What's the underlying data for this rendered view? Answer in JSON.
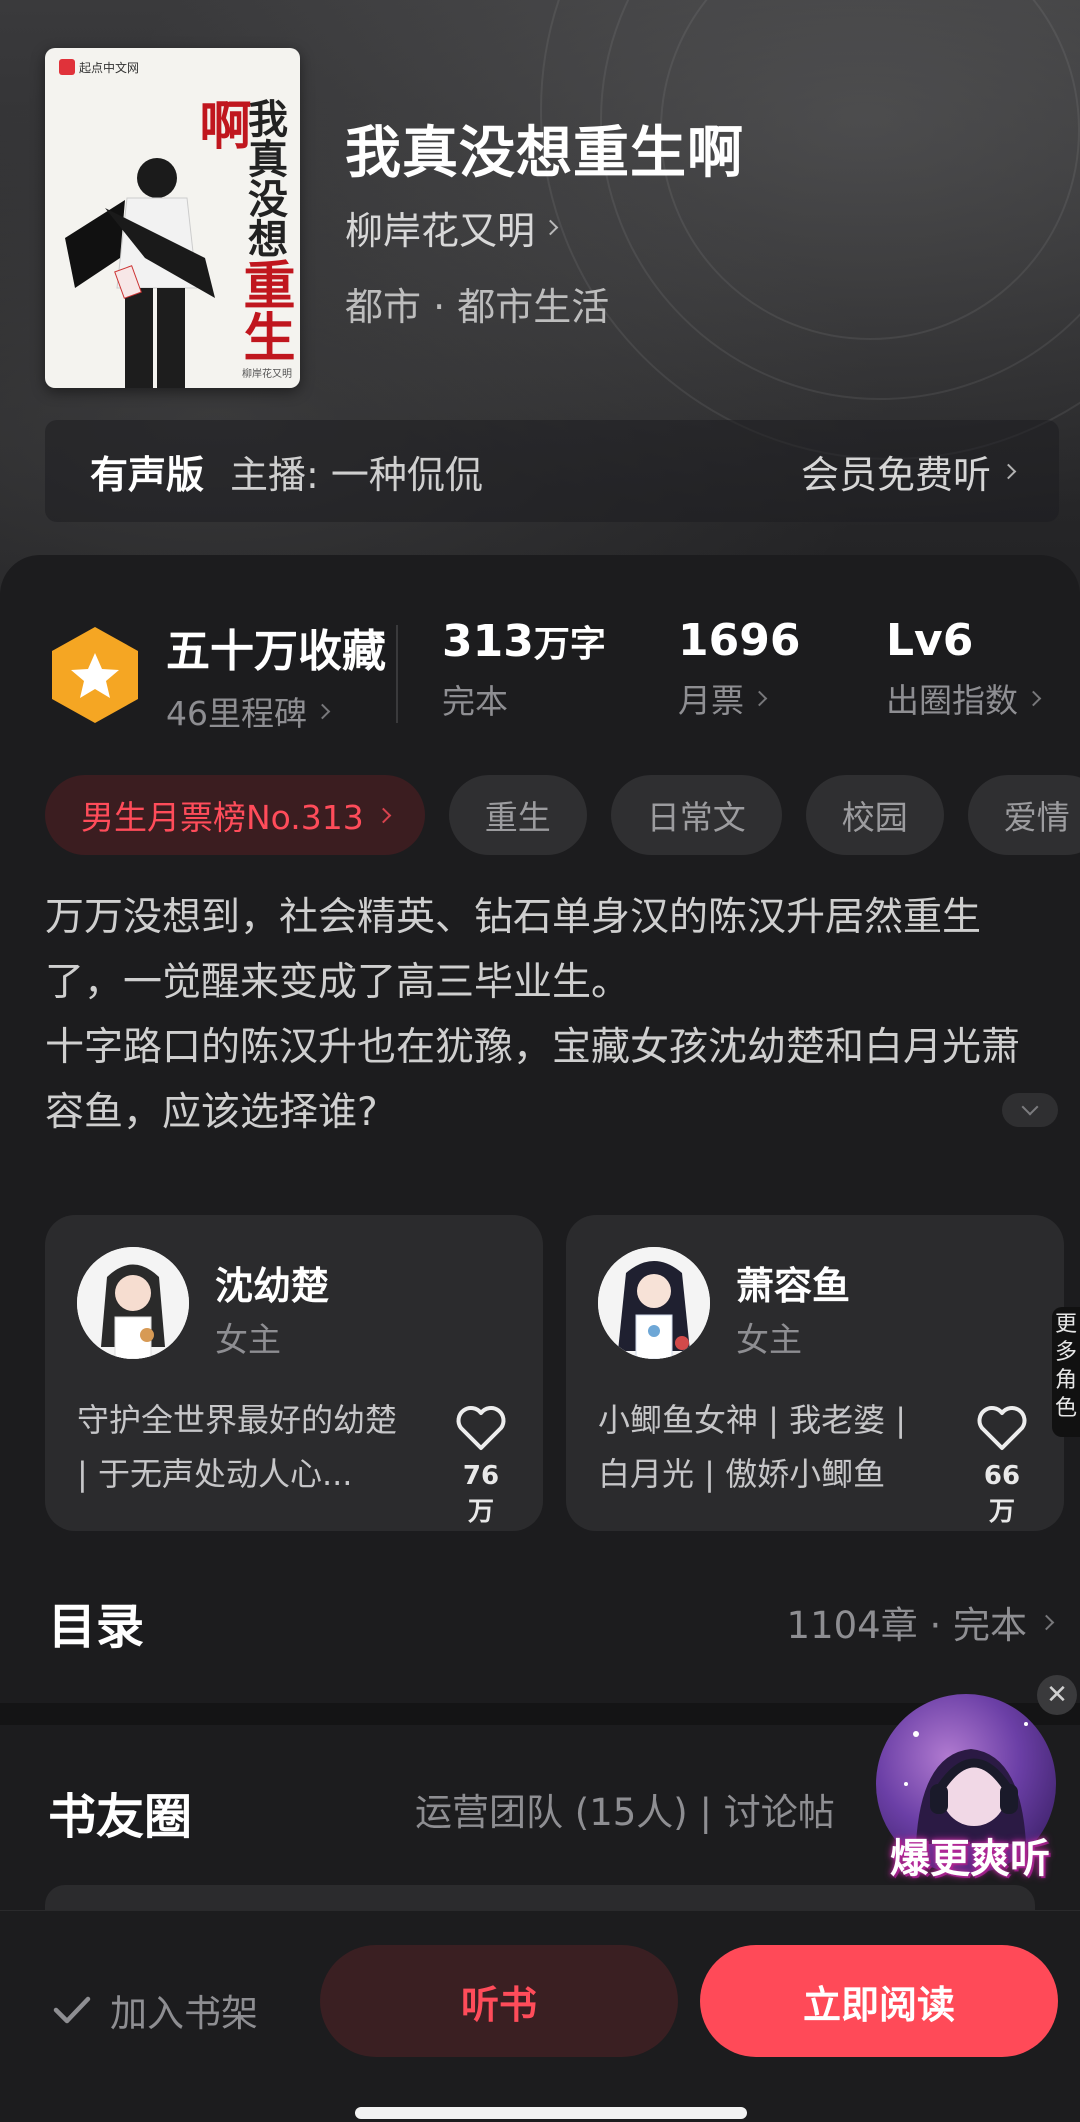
{
  "book": {
    "title": "我真没想重生啊",
    "author": "柳岸花又明",
    "genre": "都市 · 都市生活",
    "cover": {
      "publisher_badge": "起点中文网",
      "vertical_title_top": "我真没想",
      "vertical_title_accent": "重生啊",
      "author_mini": "柳岸花又明"
    }
  },
  "audio": {
    "label": "有声版",
    "anchor": "主播: 一种侃侃",
    "free": "会员免费听"
  },
  "stats": {
    "collect": {
      "big": "五十万收藏",
      "sub": "46里程碑"
    },
    "words": {
      "big": "313",
      "unit": "万字",
      "sub": "完本"
    },
    "tickets": {
      "big": "1696",
      "sub": "月票"
    },
    "level": {
      "big": "Lv6",
      "sub": "出圈指数"
    }
  },
  "tags": {
    "rank": "男生月票榜No.313",
    "items": [
      "重生",
      "日常文",
      "校园",
      "爱情"
    ]
  },
  "intro": "万万没想到，社会精英、钻石单身汉的陈汉升居然重生了，一觉醒来变成了高三毕业生。\n十字路口的陈汉升也在犹豫，宝藏女孩沈幼楚和白月光萧容鱼，应该选择谁?",
  "characters": [
    {
      "name": "沈幼楚",
      "role": "女主",
      "desc": "守护全世界最好的幼楚 | 于无声处动人心...",
      "likes": "76万"
    },
    {
      "name": "萧容鱼",
      "role": "女主",
      "desc": "小鲫鱼女神 | 我老婆 | 白月光 | 傲娇小鲫鱼",
      "likes": "66万"
    }
  ],
  "side_tab": "更多角色",
  "toc": {
    "title": "目录",
    "meta": "1104章 · 完本"
  },
  "circle": {
    "title": "书友圈",
    "meta": "运营团队 (15人) | 讨论帖"
  },
  "promo": {
    "text": "爆更爽听",
    "close": "✕"
  },
  "bottom_bar": {
    "shelf": "加入书架",
    "listen": "听书",
    "read": "立即阅读"
  },
  "colors": {
    "accent": "#ff4a58",
    "badge_gold": "#f5a623",
    "bg": "#1c1c1e"
  }
}
